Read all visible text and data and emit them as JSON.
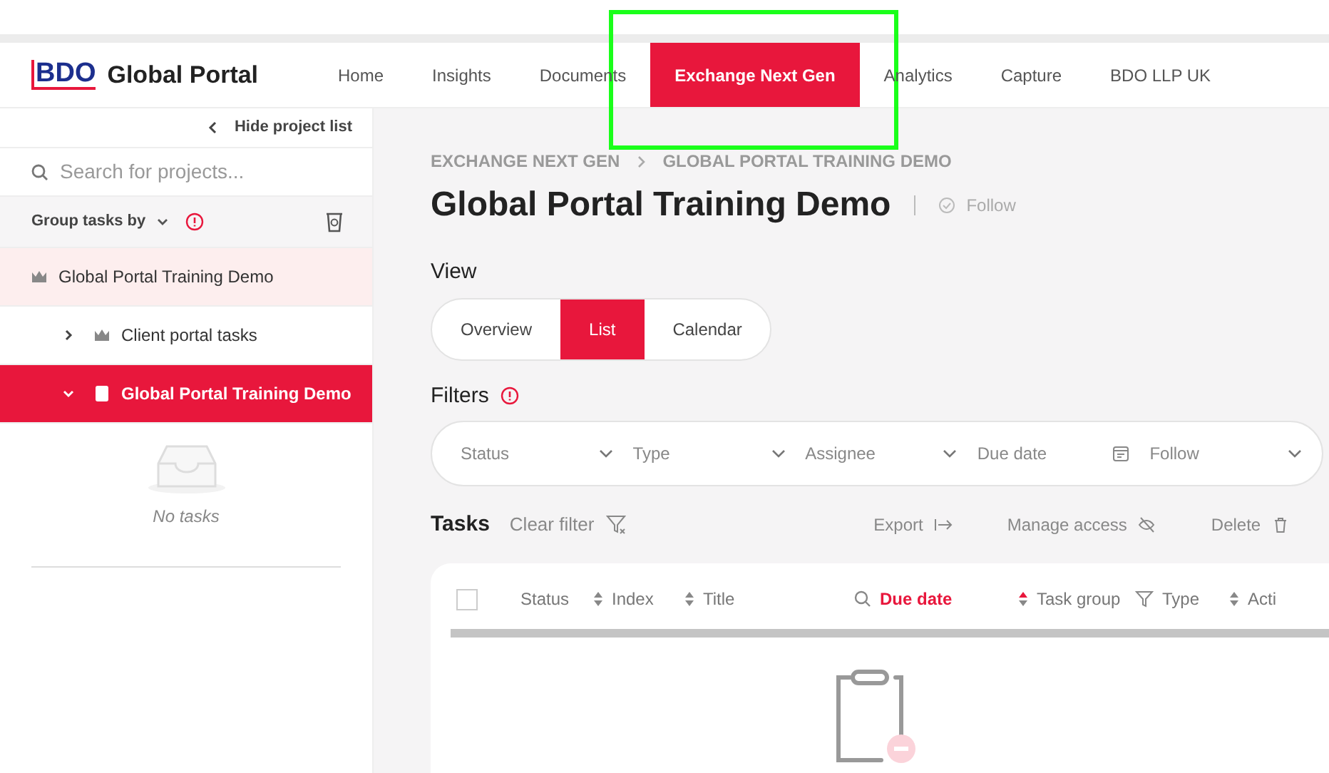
{
  "logo": {
    "mark": "BDO",
    "text": "Global Portal"
  },
  "nav": [
    {
      "label": "Home",
      "selected": false
    },
    {
      "label": "Insights",
      "selected": false
    },
    {
      "label": "Documents",
      "selected": false
    },
    {
      "label": "Exchange Next Gen",
      "selected": true
    },
    {
      "label": "Analytics",
      "selected": false
    },
    {
      "label": "Capture",
      "selected": false
    },
    {
      "label": "BDO LLP UK",
      "selected": false
    }
  ],
  "sidebar": {
    "hide_label": "Hide project list",
    "search": {
      "placeholder": "Search for projects..."
    },
    "group_label": "Group tasks by",
    "tree": [
      {
        "label": "Global Portal Training Demo",
        "kind": "crown",
        "highlighted": true,
        "selected": false,
        "children": [
          {
            "label": "Client portal tasks",
            "kind": "crown",
            "highlighted": false,
            "selected": false,
            "expanded": false
          },
          {
            "label": "Global Portal Training Demo",
            "kind": "document",
            "highlighted": false,
            "selected": true,
            "expanded": true
          }
        ]
      }
    ],
    "empty_text": "No tasks"
  },
  "breadcrumb": [
    "EXCHANGE NEXT GEN",
    "GLOBAL PORTAL TRAINING DEMO"
  ],
  "title": "Global Portal Training Demo",
  "follow": "Follow",
  "view": {
    "label": "View",
    "options": [
      {
        "label": "Overview",
        "selected": false
      },
      {
        "label": "List",
        "selected": true
      },
      {
        "label": "Calendar",
        "selected": false
      }
    ]
  },
  "filters": {
    "label": "Filters",
    "items": [
      {
        "label": "Status",
        "kind": "dropdown"
      },
      {
        "label": "Type",
        "kind": "dropdown"
      },
      {
        "label": "Assignee",
        "kind": "dropdown"
      },
      {
        "label": "Due date",
        "kind": "date"
      },
      {
        "label": "Follow",
        "kind": "dropdown"
      }
    ]
  },
  "tasks": {
    "label": "Tasks",
    "clear_filter": "Clear filter",
    "actions": [
      {
        "label": "Export",
        "kind": "export"
      },
      {
        "label": "Manage access",
        "kind": "access"
      },
      {
        "label": "Delete",
        "kind": "delete"
      }
    ],
    "select_all": {
      "checked": false
    },
    "columns": [
      {
        "label": "Status",
        "kind": "sort",
        "sorted": false
      },
      {
        "label": "Index",
        "kind": "sort",
        "sorted": false
      },
      {
        "label": "Title",
        "kind": "search",
        "sorted": false
      },
      {
        "label": "Due date",
        "kind": "sort",
        "sorted": true
      },
      {
        "label": "Task group",
        "kind": "filter",
        "sorted": false
      },
      {
        "label": "Type",
        "kind": "sort",
        "sorted": false
      },
      {
        "label": "Acti",
        "kind": "none",
        "sorted": false
      }
    ]
  }
}
